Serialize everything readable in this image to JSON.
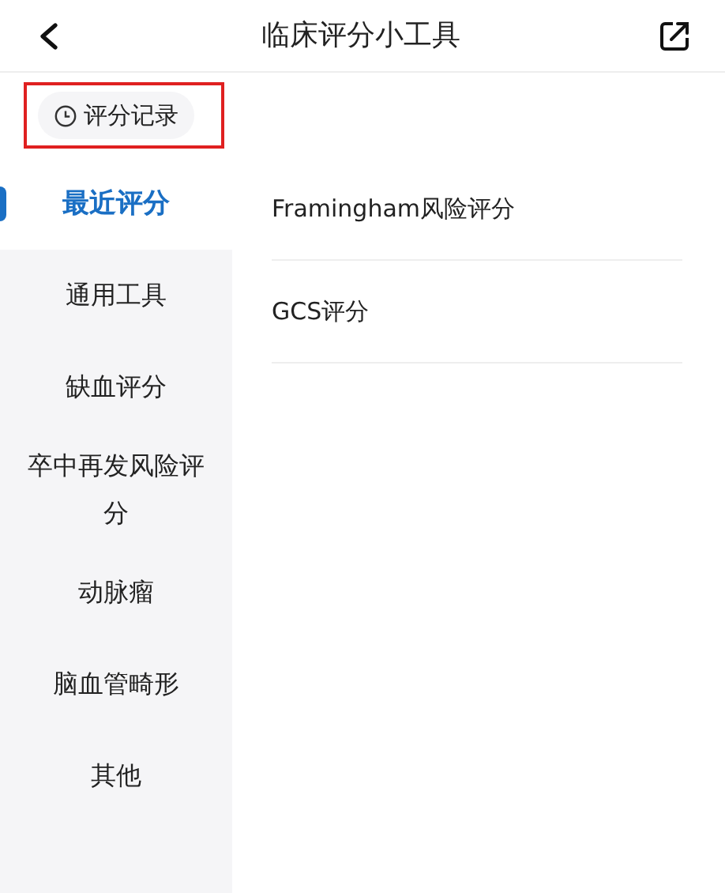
{
  "header": {
    "title": "临床评分小工具"
  },
  "record_button": {
    "label": "评分记录",
    "highlighted": true
  },
  "categories": [
    {
      "label": "最近评分",
      "selected": true
    },
    {
      "label": "通用工具",
      "selected": false
    },
    {
      "label": "缺血评分",
      "selected": false
    },
    {
      "label": "卒中再发风险评分",
      "selected": false
    },
    {
      "label": "动脉瘤",
      "selected": false
    },
    {
      "label": "脑血管畸形",
      "selected": false
    },
    {
      "label": "其他",
      "selected": false
    }
  ],
  "tools": [
    {
      "label": "Framingham风险评分"
    },
    {
      "label": "GCS评分"
    }
  ]
}
